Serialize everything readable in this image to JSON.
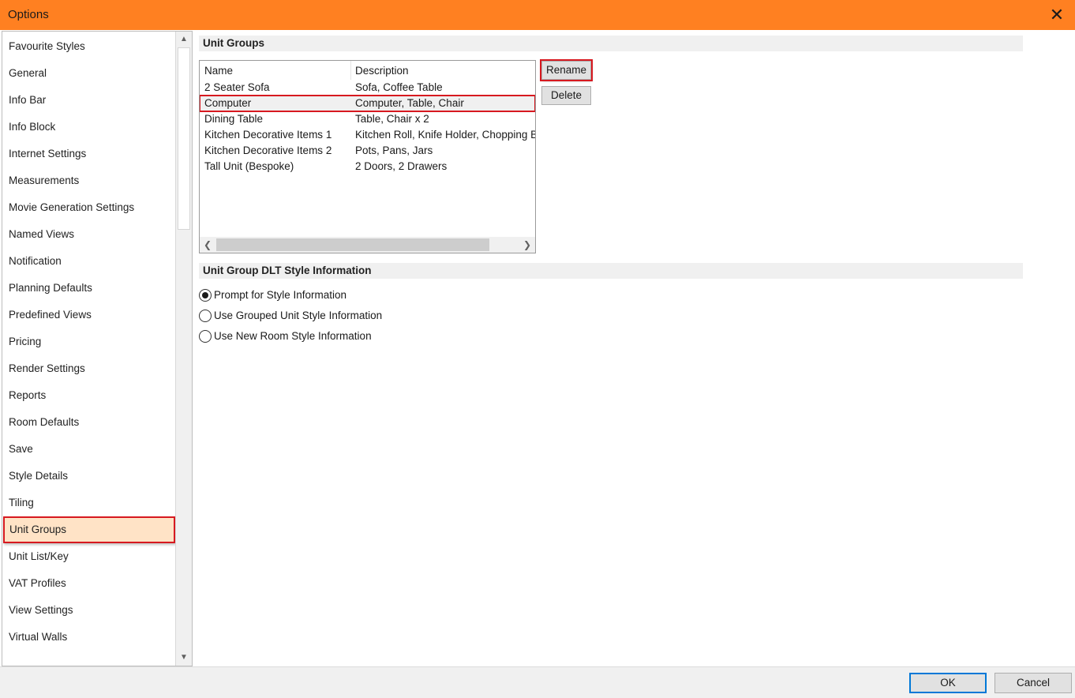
{
  "window": {
    "title": "Options",
    "close_glyph": "✕"
  },
  "sidebar": {
    "items": [
      {
        "label": "Favourite Styles"
      },
      {
        "label": "General"
      },
      {
        "label": "Info Bar"
      },
      {
        "label": "Info Block"
      },
      {
        "label": "Internet Settings"
      },
      {
        "label": "Measurements"
      },
      {
        "label": "Movie Generation Settings"
      },
      {
        "label": "Named Views"
      },
      {
        "label": "Notification"
      },
      {
        "label": "Planning Defaults"
      },
      {
        "label": "Predefined Views"
      },
      {
        "label": "Pricing"
      },
      {
        "label": "Render Settings"
      },
      {
        "label": "Reports"
      },
      {
        "label": "Room Defaults"
      },
      {
        "label": "Save"
      },
      {
        "label": "Style Details"
      },
      {
        "label": "Tiling"
      },
      {
        "label": "Unit Groups"
      },
      {
        "label": "Unit List/Key"
      },
      {
        "label": "VAT Profiles"
      },
      {
        "label": "View Settings"
      },
      {
        "label": "Virtual Walls"
      }
    ],
    "selected": "Unit Groups"
  },
  "unit_groups": {
    "header": "Unit Groups",
    "columns": {
      "name": "Name",
      "description": "Description"
    },
    "rows": [
      {
        "name": "2 Seater Sofa",
        "description": "Sofa, Coffee Table"
      },
      {
        "name": "Computer",
        "description": "Computer, Table, Chair"
      },
      {
        "name": "Dining Table",
        "description": "Table, Chair x 2"
      },
      {
        "name": "Kitchen Decorative Items 1",
        "description": "Kitchen Roll, Knife Holder, Chopping Board"
      },
      {
        "name": "Kitchen Decorative Items 2",
        "description": "Pots, Pans, Jars"
      },
      {
        "name": "Tall Unit (Bespoke)",
        "description": "2 Doors, 2 Drawers"
      }
    ],
    "selected_row": "Computer",
    "rename_label": "Rename",
    "delete_label": "Delete"
  },
  "dlt_style": {
    "header": "Unit Group DLT Style Information",
    "options": [
      {
        "label": "Prompt for Style Information",
        "checked": true
      },
      {
        "label": "Use Grouped Unit Style Information",
        "checked": false
      },
      {
        "label": "Use New Room Style Information",
        "checked": false
      }
    ]
  },
  "footer": {
    "ok_label": "OK",
    "cancel_label": "Cancel"
  },
  "icons": {
    "scroll_up": "▲",
    "scroll_down": "▼",
    "scroll_left": "❮",
    "scroll_right": "❯"
  },
  "colors": {
    "titlebar": "#ff8021",
    "highlight": "#d71920",
    "selected_bg": "#ffe3c6"
  }
}
